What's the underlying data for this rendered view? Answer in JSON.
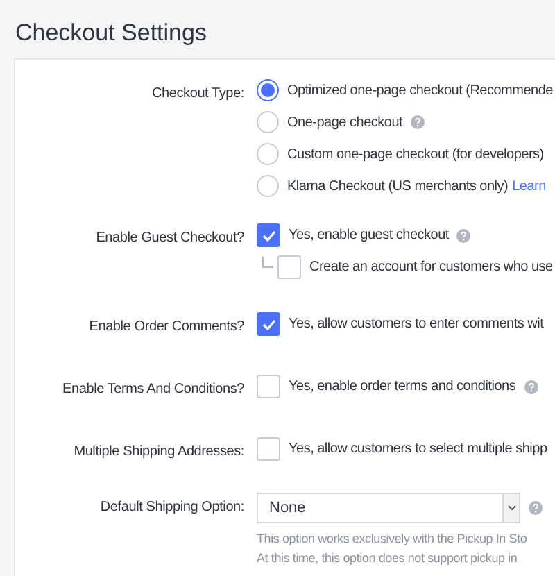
{
  "title": "Checkout Settings",
  "settings": [
    {
      "kind": "radio",
      "label": "Checkout Type:",
      "options": [
        {
          "text": "Optimized one-page checkout (Recommende",
          "selected": true,
          "help": false
        },
        {
          "text": "One-page checkout",
          "selected": false,
          "help": true
        },
        {
          "text": "Custom one-page checkout (for developers)",
          "selected": false,
          "help": false
        },
        {
          "text": "Klarna Checkout (US merchants only)",
          "selected": false,
          "help": false,
          "link": "Learn"
        }
      ]
    },
    {
      "kind": "checkbox",
      "label": "Enable Guest Checkout?",
      "options": [
        {
          "text": "Yes, enable guest checkout",
          "checked": true,
          "help": true,
          "nested": false
        },
        {
          "text": "Create an account for customers who use",
          "checked": false,
          "help": false,
          "nested": true
        }
      ]
    },
    {
      "kind": "checkbox",
      "label": "Enable Order Comments?",
      "options": [
        {
          "text": "Yes, allow customers to enter comments wit",
          "checked": true,
          "help": false,
          "nested": false
        }
      ]
    },
    {
      "kind": "checkbox",
      "label": "Enable Terms And Conditions?",
      "options": [
        {
          "text": "Yes, enable order terms and conditions",
          "checked": false,
          "help": true,
          "nested": false
        }
      ]
    },
    {
      "kind": "checkbox",
      "label": "Multiple Shipping Addresses:",
      "options": [
        {
          "text": "Yes, allow customers to select multiple shipp",
          "checked": false,
          "help": false,
          "nested": false
        }
      ]
    },
    {
      "kind": "select",
      "label": "Default Shipping Option:",
      "value": "None",
      "help": true,
      "notes": [
        "This option works exclusively with the Pickup In Sto",
        "At this time, this option does not support pickup in"
      ]
    }
  ]
}
